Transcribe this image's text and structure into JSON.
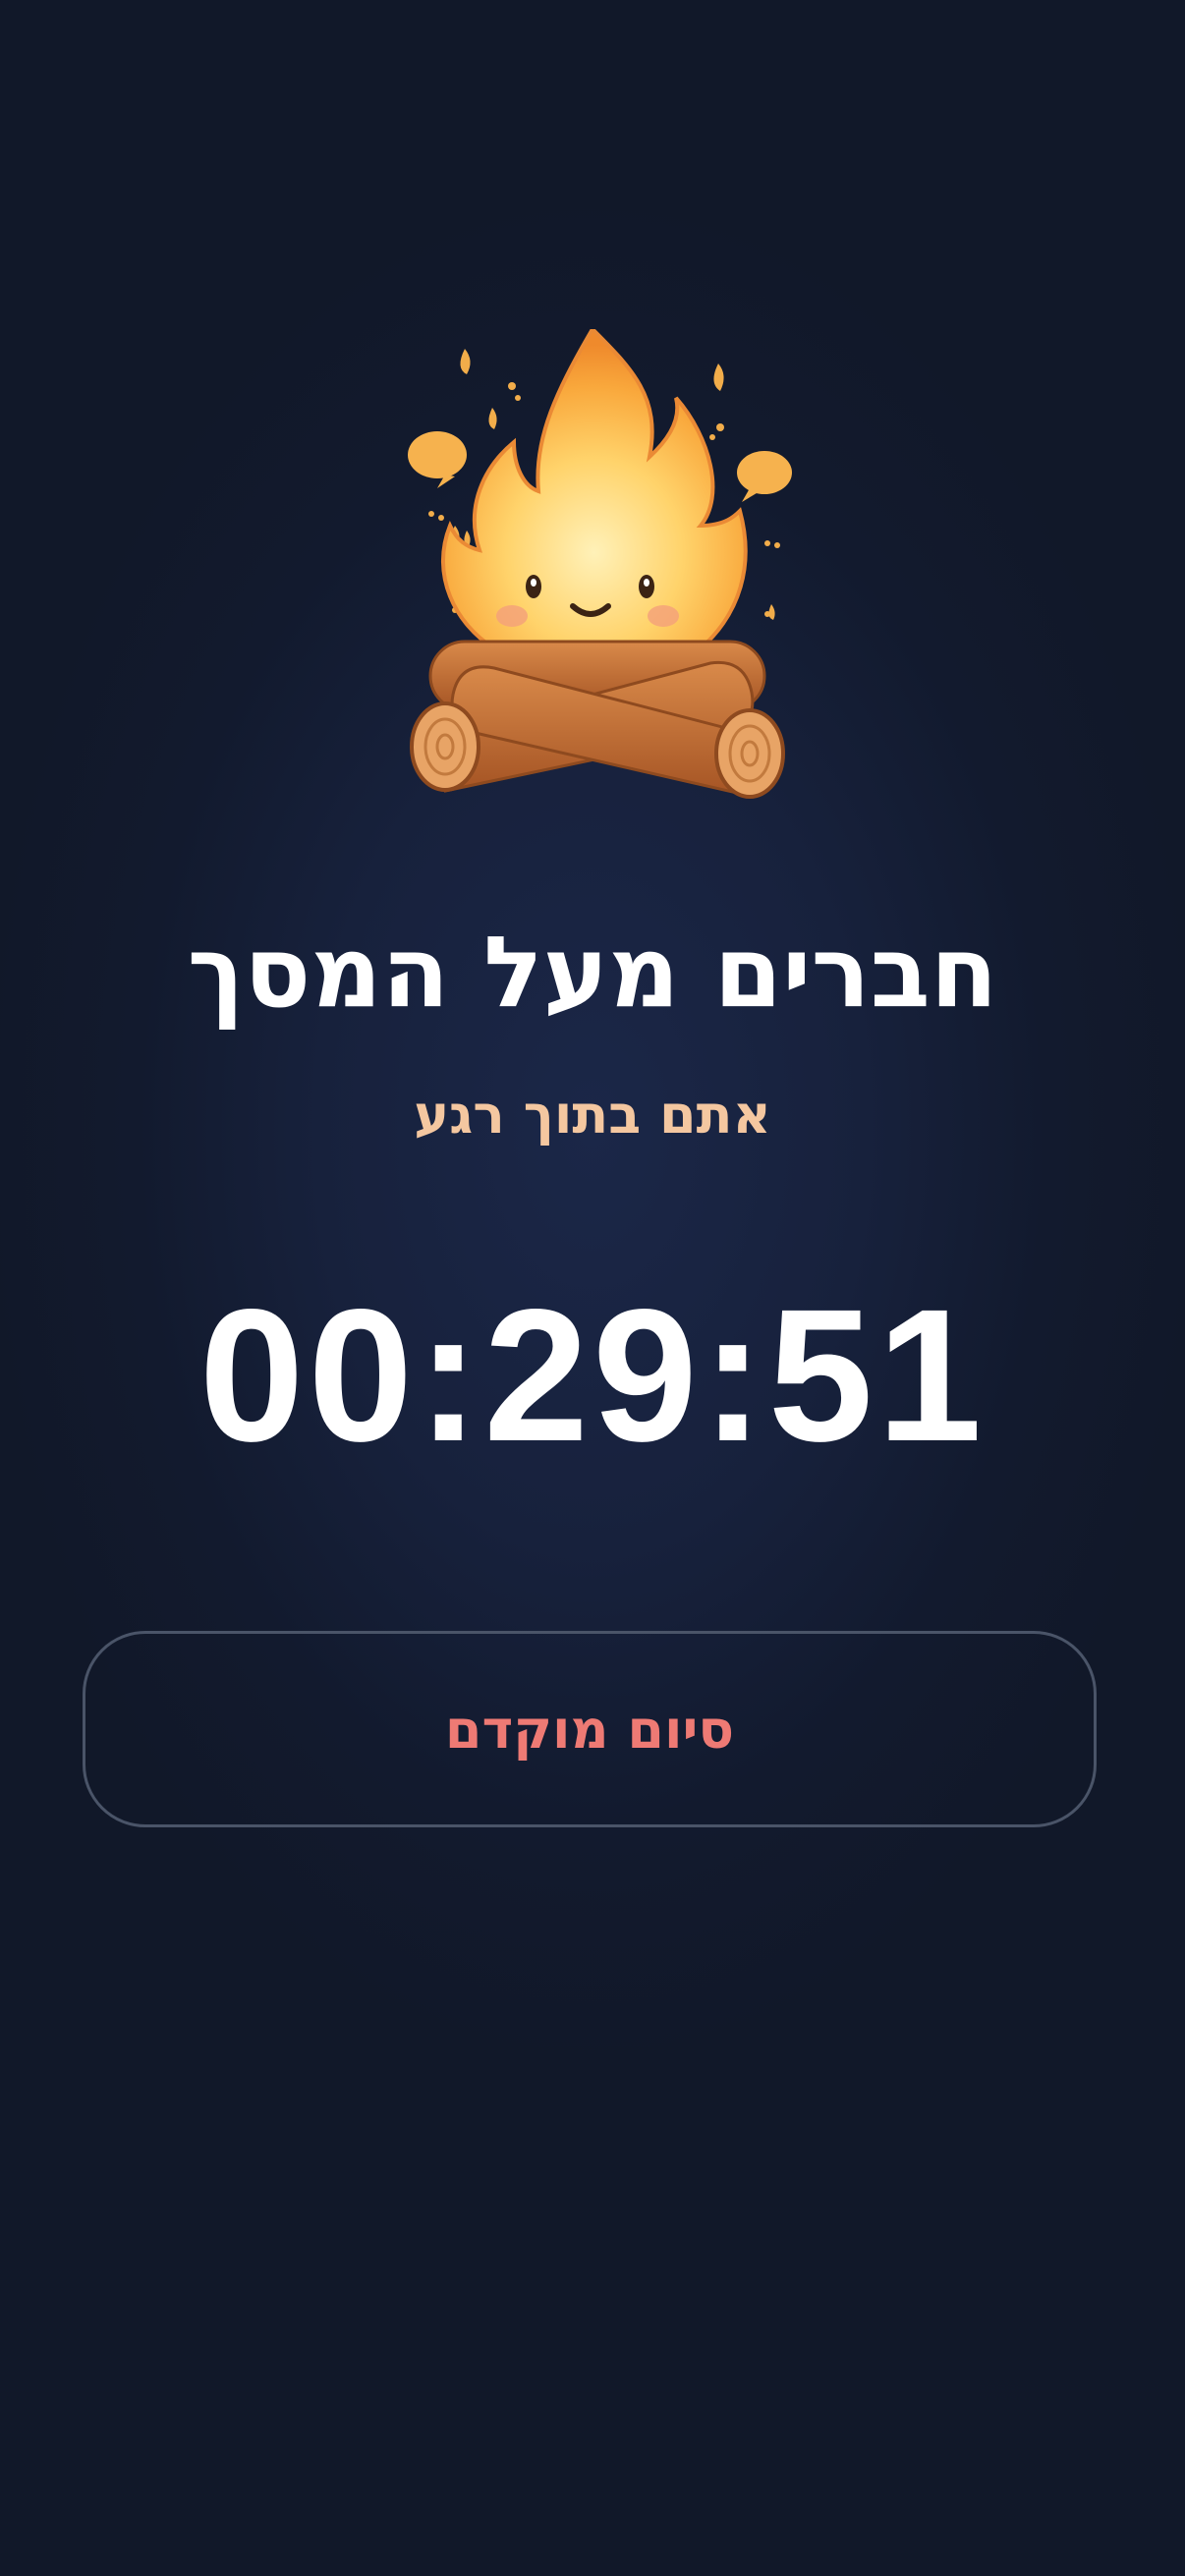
{
  "screen": {
    "icon": "campfire-icon",
    "title": "חברים מעל המסך",
    "subtitle": "אתם בתוך רגע",
    "timer": "00:29:51",
    "end_button_label": "סיום מוקדם"
  },
  "colors": {
    "background": "#141c31",
    "title": "#ffffff",
    "subtitle": "#f4c7a0",
    "timer": "#ffffff",
    "end_button_text": "#ee7a74",
    "end_button_border": "#4a5468"
  }
}
